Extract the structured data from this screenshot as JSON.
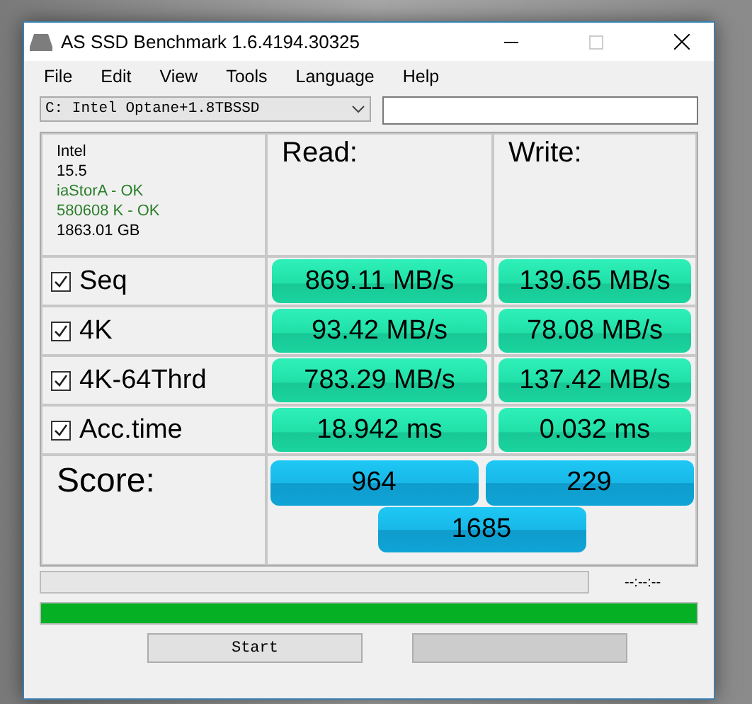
{
  "window": {
    "title": "AS SSD Benchmark 1.6.4194.30325"
  },
  "menu": [
    "File",
    "Edit",
    "View",
    "Tools",
    "Language",
    "Help"
  ],
  "drive_select": {
    "value": "C: Intel Optane+1.8TBSSD"
  },
  "info": [
    {
      "text": "Intel",
      "ok": false
    },
    {
      "text": "15.5",
      "ok": false
    },
    {
      "text": "iaStorA - OK",
      "ok": true
    },
    {
      "text": "580608 K - OK",
      "ok": true
    },
    {
      "text": "1863.01 GB",
      "ok": false
    }
  ],
  "headers": {
    "read": "Read:",
    "write": "Write:"
  },
  "tests": [
    {
      "name": "Seq",
      "checked": true,
      "read": "869.11 MB/s",
      "write": "139.65 MB/s"
    },
    {
      "name": "4K",
      "checked": true,
      "read": "93.42 MB/s",
      "write": "78.08 MB/s"
    },
    {
      "name": "4K-64Thrd",
      "checked": true,
      "read": "783.29 MB/s",
      "write": "137.42 MB/s"
    },
    {
      "name": "Acc.time",
      "checked": true,
      "read": "18.942 ms",
      "write": "0.032 ms"
    }
  ],
  "score": {
    "label": "Score:",
    "read": "964",
    "write": "229",
    "total": "1685"
  },
  "test_progress": {
    "level": 0,
    "time": "--:--:--"
  },
  "total_progress": {
    "level": 1
  },
  "buttons": [
    {
      "label": "Start",
      "disabled": false
    },
    {
      "disabled": true
    }
  ]
}
